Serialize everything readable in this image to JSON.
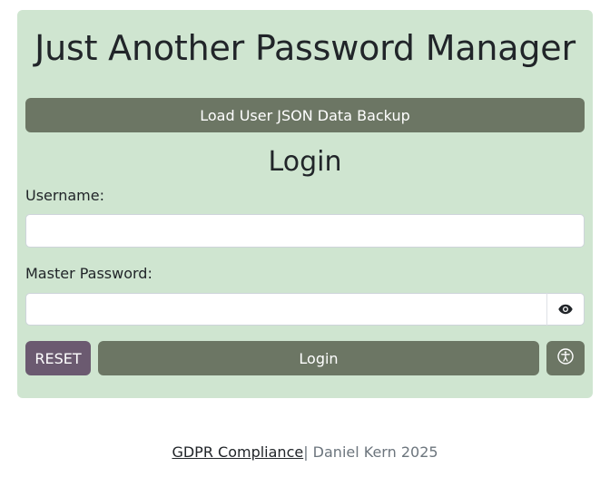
{
  "app": {
    "title": "Just Another Password Manager"
  },
  "backup": {
    "load_label": "Load User JSON Data Backup"
  },
  "login": {
    "heading": "Login",
    "username_label": "Username:",
    "username_value": "",
    "password_label": "Master Password:",
    "password_value": "",
    "reset_label": "RESET",
    "submit_label": "Login",
    "toggle_visibility_icon": "eye-icon",
    "accessibility_icon": "accessibility-icon"
  },
  "footer": {
    "gdpr_link": "GDPR Compliance",
    "credit": "| Daniel Kern 2025"
  },
  "colors": {
    "card_background": "#cfe5d0",
    "primary_button": "#6c7664",
    "reset_button": "#6b5a70"
  }
}
